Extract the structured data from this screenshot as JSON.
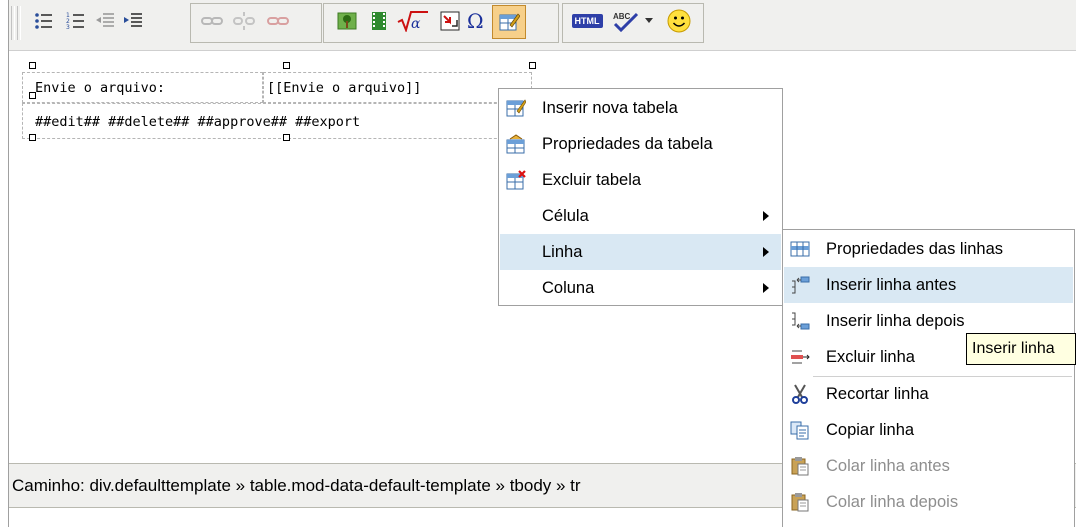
{
  "toolbar": {
    "icons": [
      "bullet-list-icon",
      "numbered-list-icon",
      "outdent-icon",
      "indent-icon",
      "link-icon",
      "unlink-icon",
      "anchor-icon",
      "image-icon",
      "media-icon",
      "equation-icon",
      "table-icon",
      "special-char-icon",
      "table-props-icon",
      "html-icon",
      "spellcheck-icon",
      "dropdown-icon",
      "smiley-icon"
    ],
    "html_label": "HTML",
    "spell_label": "ABC"
  },
  "content": {
    "cell_1": "Envie o arquivo:",
    "cell_2": "[[Envie o arquivo]]",
    "row_2": "##edit## ##delete## ##approve## ##export"
  },
  "pathbar": {
    "text": "Caminho: div.defaulttemplate » table.mod-data-default-template » tbody » tr"
  },
  "context_menu": {
    "items": [
      {
        "label": "Inserir nova tabela",
        "icon": "table-insert-icon"
      },
      {
        "label": "Propriedades da tabela",
        "icon": "table-properties-icon"
      },
      {
        "label": "Excluir tabela",
        "icon": "table-delete-icon"
      },
      {
        "label": "Célula",
        "icon": ""
      },
      {
        "label": "Linha",
        "icon": ""
      },
      {
        "label": "Coluna",
        "icon": ""
      }
    ]
  },
  "submenu": {
    "items": [
      {
        "label": "Propriedades das linhas",
        "icon": "row-properties-icon",
        "disabled": false
      },
      {
        "label": "Inserir linha antes",
        "icon": "insert-row-before-icon",
        "disabled": false
      },
      {
        "label": "Inserir linha depois",
        "icon": "insert-row-after-icon",
        "disabled": false
      },
      {
        "label": "Excluir linha",
        "icon": "delete-row-icon",
        "disabled": false
      },
      {
        "label": "Recortar linha",
        "icon": "cut-icon",
        "disabled": false
      },
      {
        "label": "Copiar linha",
        "icon": "copy-icon",
        "disabled": false
      },
      {
        "label": "Colar linha antes",
        "icon": "paste-icon",
        "disabled": true
      },
      {
        "label": "Colar linha depois",
        "icon": "paste-icon",
        "disabled": true
      }
    ]
  },
  "tooltip": {
    "text": "Inserir linha"
  },
  "colors": {
    "menu_highlight": "#d9e8f3",
    "toolbar_bg": "#f0f0ee",
    "tooltip_bg": "#ffffe1"
  }
}
